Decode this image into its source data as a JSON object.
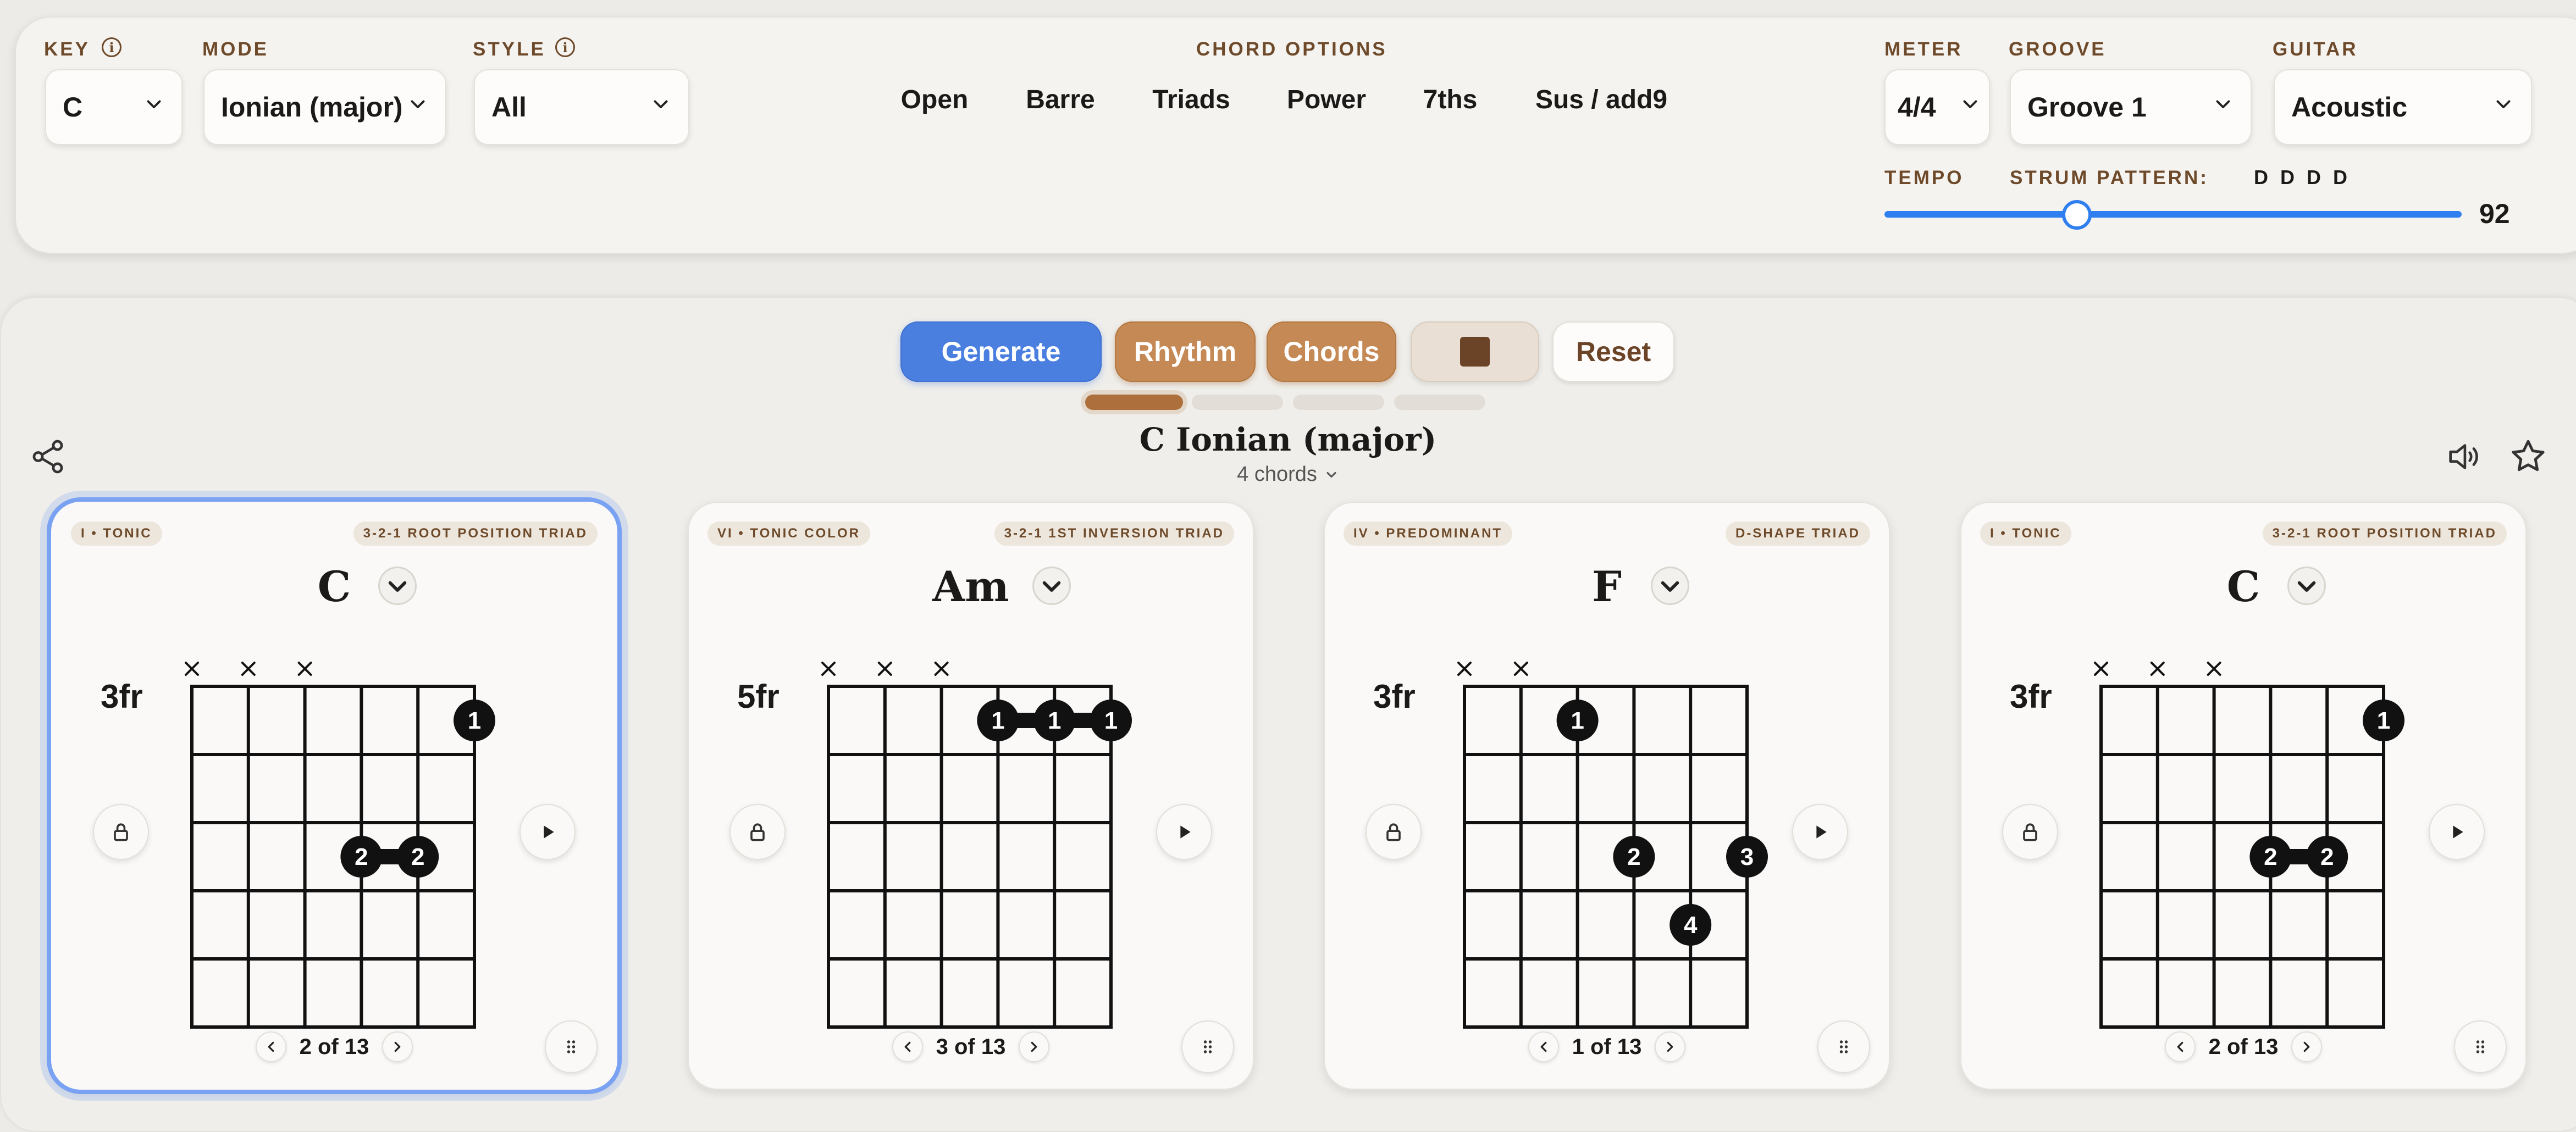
{
  "controls": {
    "key": {
      "label": "KEY",
      "value": "C"
    },
    "mode": {
      "label": "MODE",
      "value": "Ionian (major)"
    },
    "style": {
      "label": "STYLE",
      "value": "All"
    },
    "chord_options": {
      "label": "CHORD OPTIONS",
      "chips": [
        {
          "label": "Open",
          "active": false
        },
        {
          "label": "Barre",
          "active": false
        },
        {
          "label": "Triads",
          "active": true
        },
        {
          "label": "Power",
          "active": false
        },
        {
          "label": "7ths",
          "active": true
        },
        {
          "label": "Sus / add9",
          "active": true
        }
      ]
    },
    "meter": {
      "label": "METER",
      "value": "4/4"
    },
    "groove": {
      "label": "GROOVE",
      "value": "Groove 1"
    },
    "guitar": {
      "label": "GUITAR",
      "value": "Acoustic"
    },
    "tempo": {
      "label": "TEMPO",
      "value": "92",
      "min_hint": 40,
      "max_hint": 200
    },
    "strum": {
      "label": "STRUM PATTERN:",
      "value": "D D D D"
    }
  },
  "actions": {
    "generate": "Generate",
    "rhythm": "Rhythm",
    "chords": "Chords",
    "reset": "Reset",
    "progress_step": 1,
    "progress_total": 4
  },
  "progression": {
    "title": "C Ionian (major)",
    "count_label": "4 chords"
  },
  "colors": {
    "accent": "#c58955",
    "primary": "#4a7fe0",
    "stop": "#6b4428",
    "selected_border": "#7aa2f3"
  },
  "cards": [
    {
      "function": "I • TONIC",
      "voicing": "3-2-1 ROOT POSITION TRIAD",
      "name": "C",
      "fret": "3fr",
      "muted": [
        1,
        2,
        3
      ],
      "dots": [
        {
          "s": 6,
          "f": 1,
          "n": "1"
        },
        {
          "s": 4,
          "f": 3,
          "n": "2"
        },
        {
          "s": 5,
          "f": 3,
          "n": "2"
        }
      ],
      "bars": [
        {
          "f": 3,
          "from": 4,
          "to": 5
        }
      ],
      "pager": "2 of 13",
      "selected": true
    },
    {
      "function": "VI • TONIC COLOR",
      "voicing": "3-2-1 1ST INVERSION TRIAD",
      "name": "Am",
      "fret": "5fr",
      "muted": [
        1,
        2,
        3
      ],
      "dots": [
        {
          "s": 4,
          "f": 1,
          "n": "1"
        },
        {
          "s": 5,
          "f": 1,
          "n": "1"
        },
        {
          "s": 6,
          "f": 1,
          "n": "1"
        }
      ],
      "bars": [
        {
          "f": 1,
          "from": 4,
          "to": 6
        }
      ],
      "pager": "3 of 13",
      "selected": false
    },
    {
      "function": "IV • PREDOMINANT",
      "voicing": "D-SHAPE TRIAD",
      "name": "F",
      "fret": "3fr",
      "muted": [
        1,
        2
      ],
      "dots": [
        {
          "s": 3,
          "f": 1,
          "n": "1"
        },
        {
          "s": 4,
          "f": 3,
          "n": "2"
        },
        {
          "s": 6,
          "f": 3,
          "n": "3"
        },
        {
          "s": 5,
          "f": 4,
          "n": "4"
        }
      ],
      "bars": [],
      "pager": "1 of 13",
      "selected": false
    },
    {
      "function": "I • TONIC",
      "voicing": "3-2-1 ROOT POSITION TRIAD",
      "name": "C",
      "fret": "3fr",
      "muted": [
        1,
        2,
        3
      ],
      "dots": [
        {
          "s": 6,
          "f": 1,
          "n": "1"
        },
        {
          "s": 4,
          "f": 3,
          "n": "2"
        },
        {
          "s": 5,
          "f": 3,
          "n": "2"
        }
      ],
      "bars": [
        {
          "f": 3,
          "from": 4,
          "to": 5
        }
      ],
      "pager": "2 of 13",
      "selected": false
    }
  ]
}
